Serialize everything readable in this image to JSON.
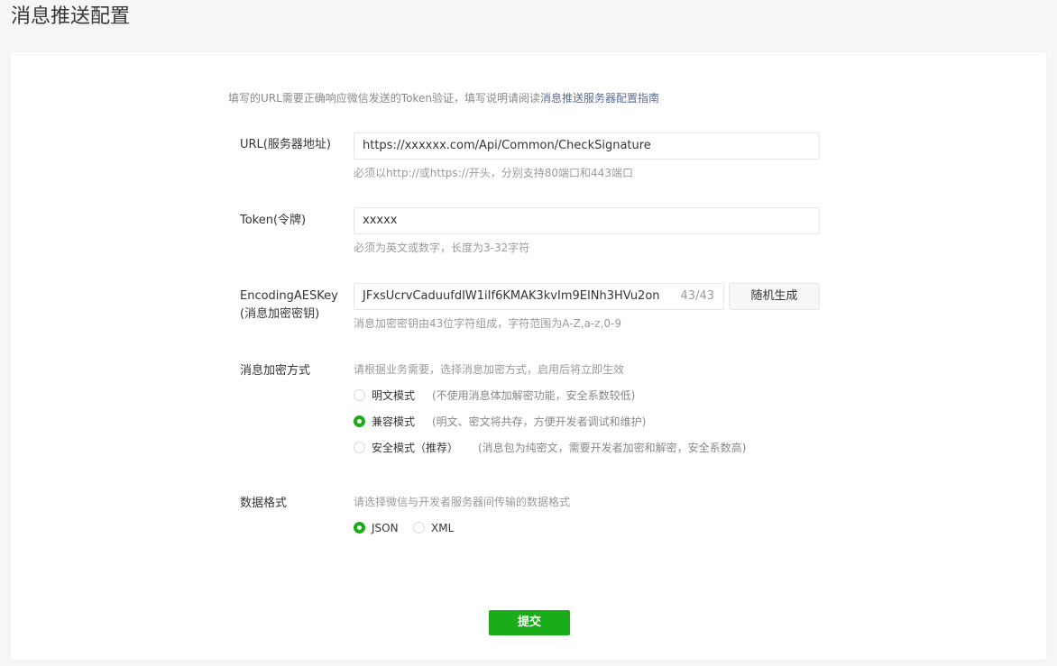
{
  "page": {
    "title": "消息推送配置"
  },
  "intro": {
    "text": "填写的URL需要正确响应微信发送的Token验证，填写说明请阅读",
    "link": "消息推送服务器配置指南"
  },
  "url": {
    "label": "URL(服务器地址)",
    "value": "https://xxxxxx.com/Api/Common/CheckSignature",
    "hint": "必须以http://或https://开头，分别支持80端口和443端口"
  },
  "token": {
    "label": "Token(令牌)",
    "value": "xxxxx",
    "hint": "必须为英文或数字，长度为3-32字符"
  },
  "aeskey": {
    "label_line1": "EncodingAESKey",
    "label_line2": "(消息加密密钥)",
    "value": "JFxsUcrvCaduufdIW1iIf6KMAK3kvIm9EINh3HVu2on",
    "counter": "43/43",
    "generate_button": "随机生成",
    "hint": "消息加密密钥由43位字符组成，字符范围为A-Z,a-z,0-9"
  },
  "encryption": {
    "label": "消息加密方式",
    "hint": "请根据业务需要，选择消息加密方式，启用后将立即生效",
    "options": [
      {
        "label": "明文模式",
        "desc": "(不使用消息体加解密功能，安全系数较低)",
        "checked": false
      },
      {
        "label": "兼容模式",
        "desc": "(明文、密文将共存，方便开发者调试和维护)",
        "checked": true
      },
      {
        "label": "安全模式（推荐）",
        "desc": "(消息包为纯密文，需要开发者加密和解密，安全系数高)",
        "checked": false
      }
    ]
  },
  "format": {
    "label": "数据格式",
    "hint": "请选择微信与开发者服务器间传输的数据格式",
    "options": [
      {
        "label": "JSON",
        "checked": true
      },
      {
        "label": "XML",
        "checked": false
      }
    ]
  },
  "submit": {
    "label": "提交"
  },
  "colors": {
    "accent": "#1aad19",
    "link": "#576b95",
    "hint": "#9a9a9a",
    "background": "#f6f6f6"
  }
}
